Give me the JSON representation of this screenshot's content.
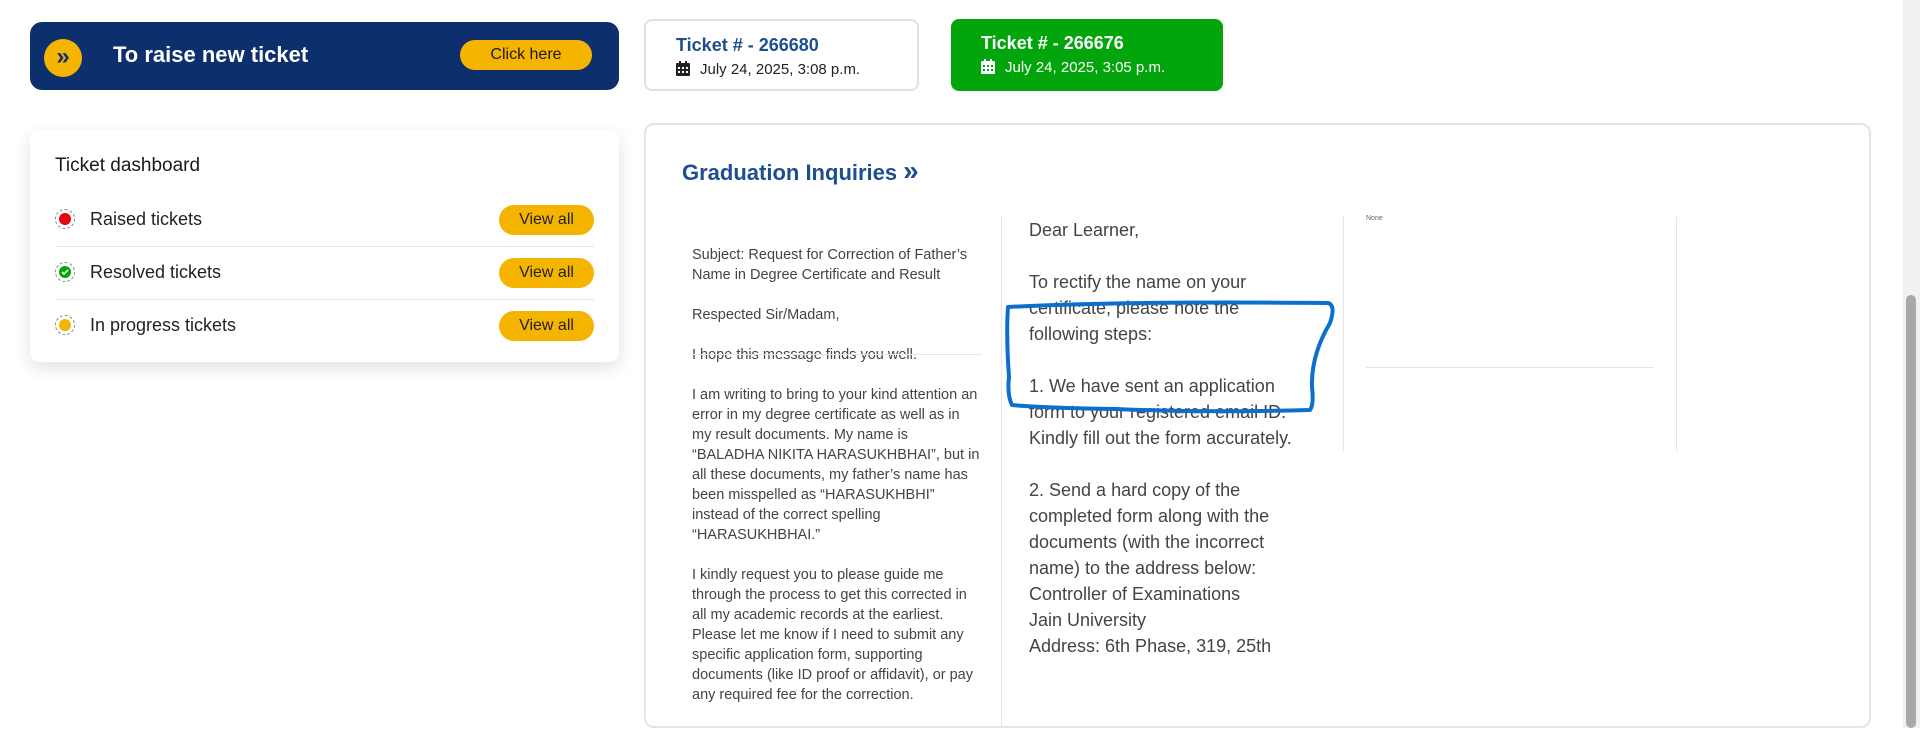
{
  "raise_banner": {
    "title": "To raise new ticket",
    "button_label": "Click here",
    "icon_glyph": "»"
  },
  "tickets": [
    {
      "number": "Ticket # - 266680",
      "date": "July 24, 2025, 3:08 p.m.",
      "active": false
    },
    {
      "number": "Ticket # - 266676",
      "date": "July 24, 2025, 3:05 p.m.",
      "active": true
    }
  ],
  "dashboard": {
    "title": "Ticket dashboard",
    "rows": [
      {
        "label": "Raised tickets",
        "button": "View all",
        "color": "#e30613"
      },
      {
        "label": "Resolved tickets",
        "button": "View all",
        "color": "#02a60c"
      },
      {
        "label": "In progress tickets",
        "button": "View all",
        "color": "#f5b400"
      }
    ]
  },
  "panel": {
    "title": "Graduation Inquiries",
    "title_icon": "»",
    "query": {
      "subject": "Subject: Request for Correction of Father’s Name in Degree Certificate and Result",
      "greeting": "Respected Sir/Madam,",
      "intro": "I hope this message finds you well.",
      "body1": "I am writing to bring to your kind attention an error in my degree certificate as well as in my result documents. My name is “BALADHA NIKITA HARASUKHBHAI”, but in all these documents, my father’s name has been misspelled as “HARASUKHBHI” instead of the correct spelling “HARASUKHBHAI.”",
      "body2": "I kindly request you to please guide me through the process to get this corrected in all my academic records at the earliest. Please let me know if I need to submit any specific application form, supporting documents (like ID proof or affidavit), or pay any required fee for the correction."
    },
    "reply": {
      "greeting": "Dear Learner,",
      "intro": "To rectify the name on your certificate, please note the following steps:",
      "step1": "1. We have sent an application form to your registered email ID. Kindly fill out the form accurately.",
      "step2": "2. Send a hard copy of the completed form along with the documents (with the incorrect name) to the address below:",
      "line1": "Controller of Examinations",
      "line2": "Jain University",
      "line3": "Address: 6th Phase, 319, 25th"
    },
    "attachment_text": "None"
  },
  "colors": {
    "navy": "#0e2f6e",
    "accent_yellow": "#f5b400",
    "active_green": "#02a60c",
    "link_blue": "#1d4e8f",
    "annotation_blue": "#0b6fcf"
  }
}
